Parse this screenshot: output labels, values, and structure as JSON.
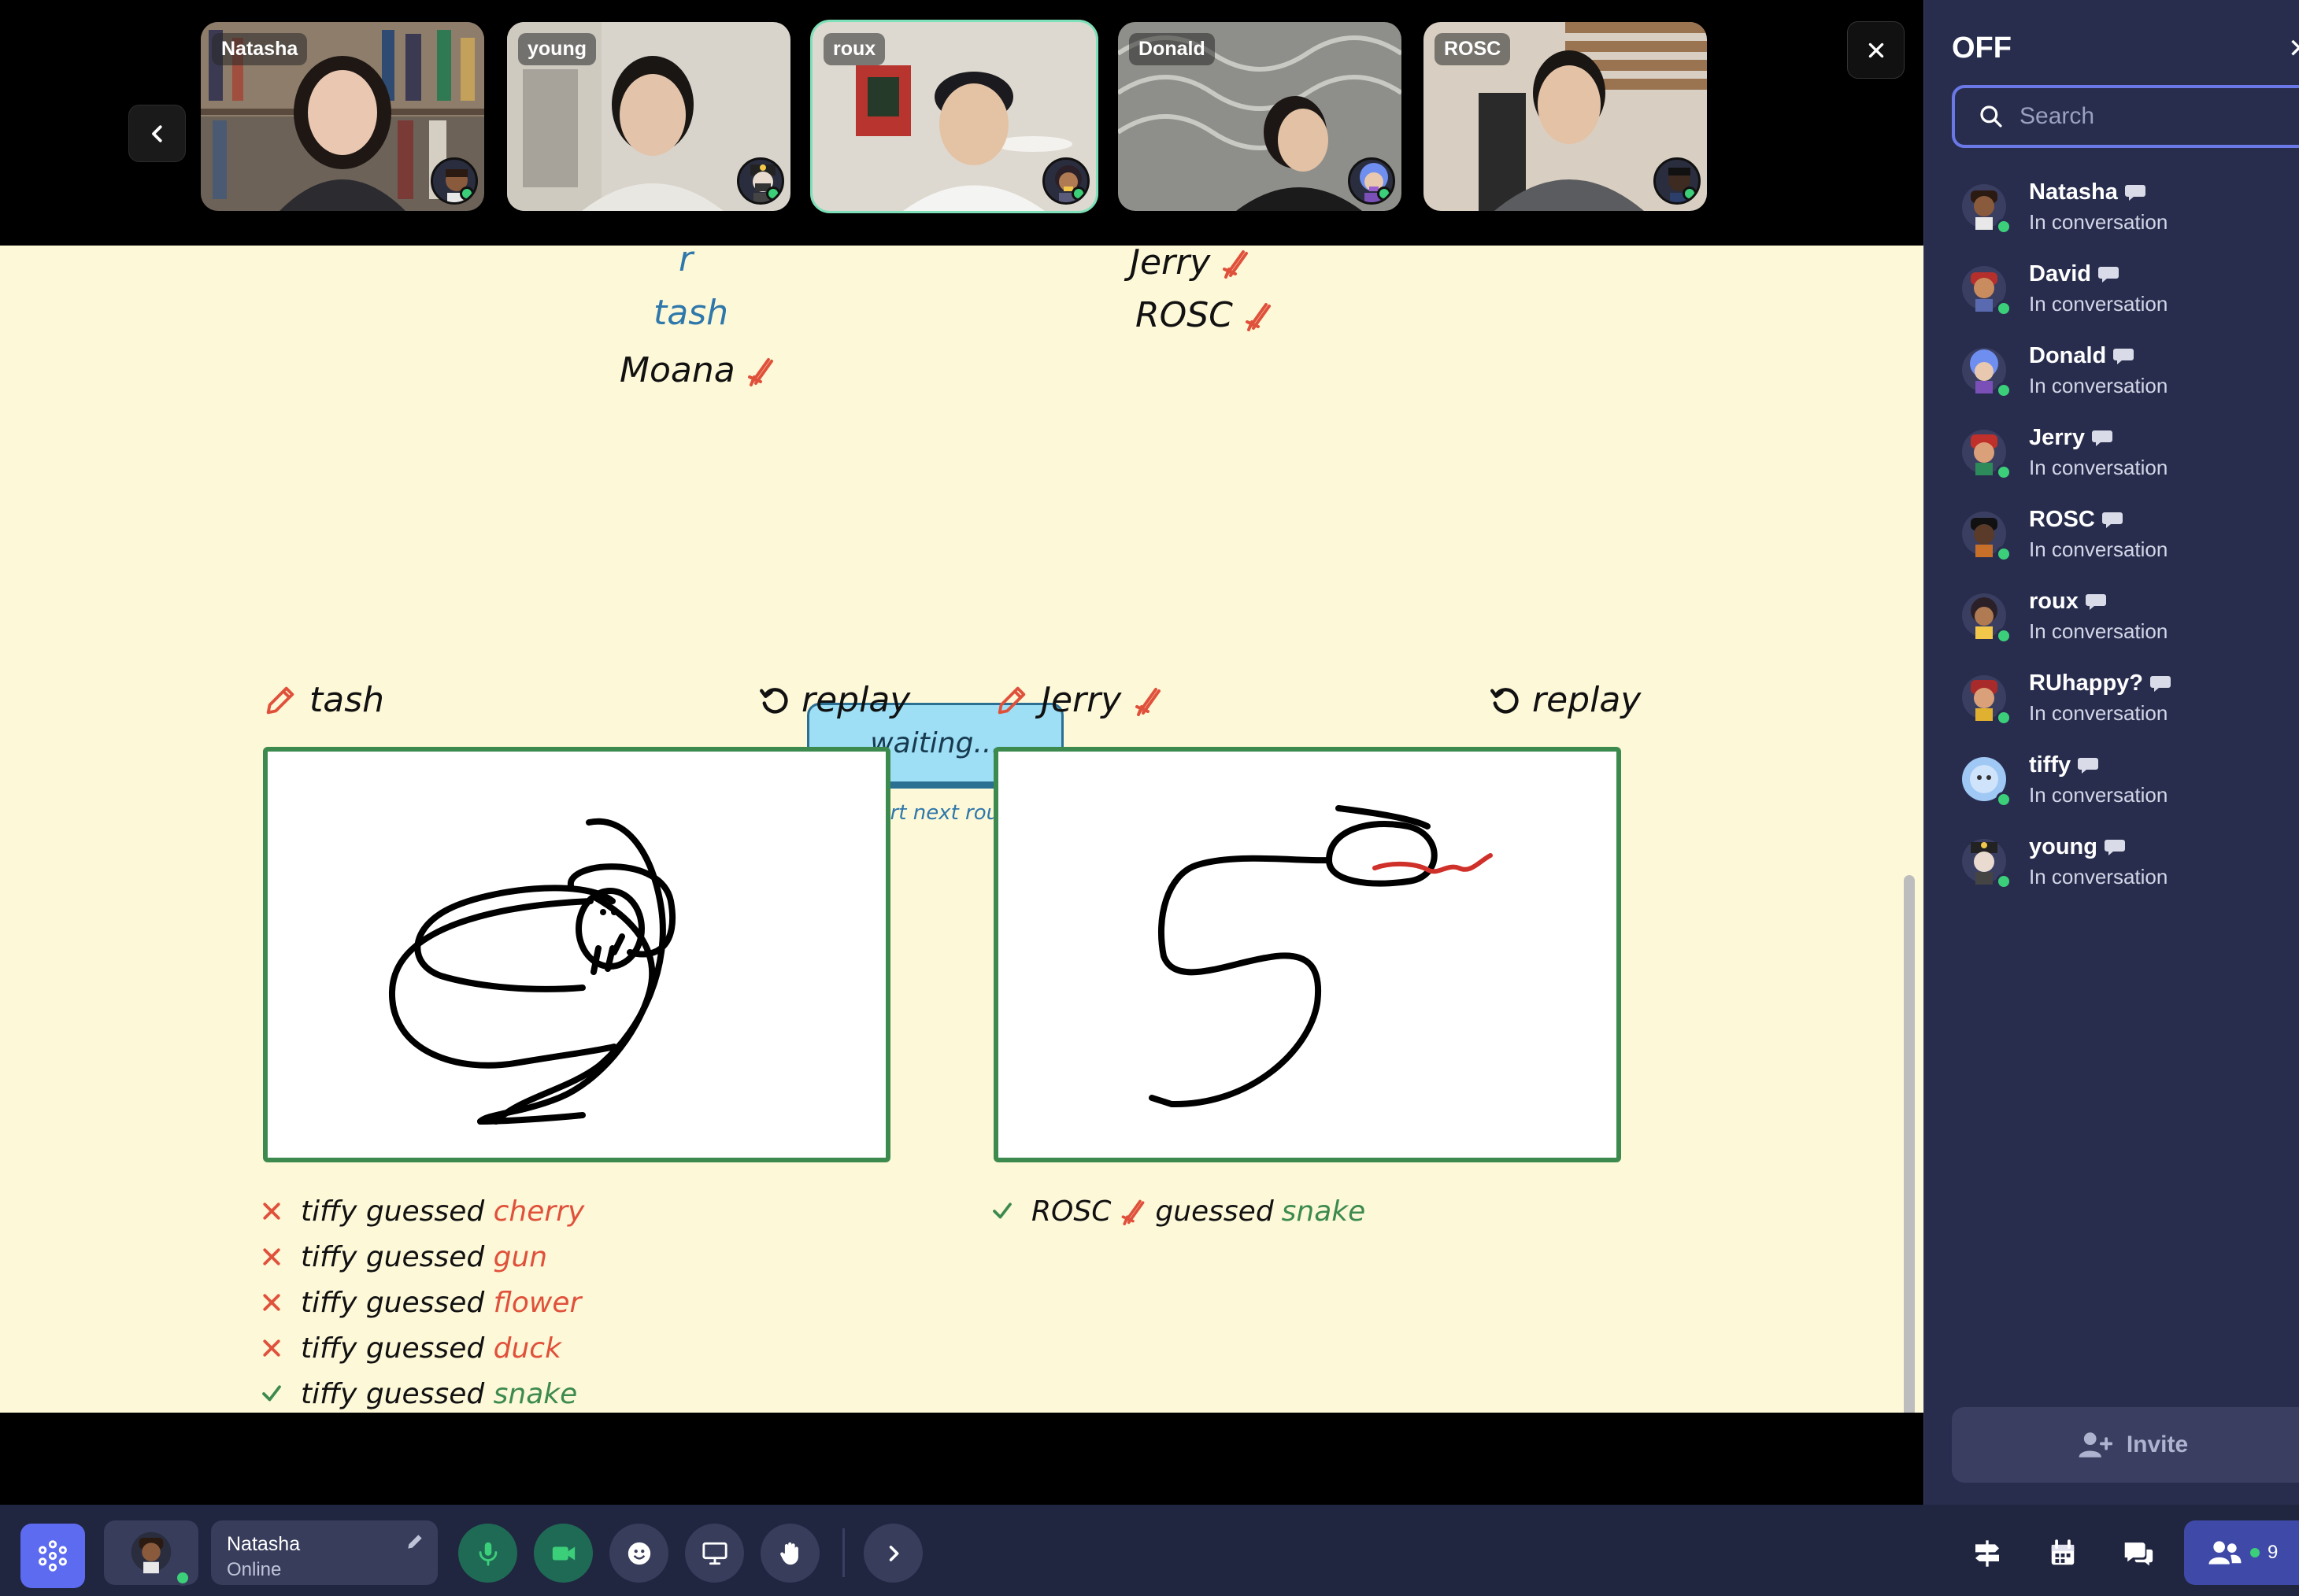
{
  "strip": {
    "tiles": [
      {
        "name": "Natasha"
      },
      {
        "name": "young"
      },
      {
        "name": "roux"
      },
      {
        "name": "Donald"
      },
      {
        "name": "ROSC"
      }
    ]
  },
  "scoreboard": {
    "left": [
      {
        "name": "r",
        "highlight": true,
        "icon": false
      },
      {
        "name": "tash",
        "highlight": true,
        "icon": false
      },
      {
        "name": "Moana",
        "highlight": false,
        "icon": true
      }
    ],
    "right": [
      {
        "name": "Jerry",
        "icon": true
      },
      {
        "name": "ROSC",
        "icon": true
      }
    ]
  },
  "round": {
    "waiting_label": "waiting...",
    "next_label": "start next round"
  },
  "cards": [
    {
      "artist": "tash",
      "replay_label": "replay",
      "guesses": [
        {
          "guesser": "tiffy",
          "verb": "guessed",
          "word": "cherry",
          "correct": false
        },
        {
          "guesser": "tiffy",
          "verb": "guessed",
          "word": "gun",
          "correct": false
        },
        {
          "guesser": "tiffy",
          "verb": "guessed",
          "word": "flower",
          "correct": false
        },
        {
          "guesser": "tiffy",
          "verb": "guessed",
          "word": "duck",
          "correct": false
        },
        {
          "guesser": "tiffy",
          "verb": "guessed",
          "word": "snake",
          "correct": true
        }
      ]
    },
    {
      "artist": "Jerry",
      "replay_label": "replay",
      "guesses": [
        {
          "guesser": "ROSC",
          "verb": "guessed",
          "word": "snake",
          "correct": true
        }
      ]
    }
  ],
  "sidebar": {
    "title": "OFF",
    "search_placeholder": "Search",
    "members": [
      {
        "name": "Natasha",
        "status": "In conversation"
      },
      {
        "name": "David",
        "status": "In conversation"
      },
      {
        "name": "Donald",
        "status": "In conversation"
      },
      {
        "name": "Jerry",
        "status": "In conversation"
      },
      {
        "name": "ROSC",
        "status": "In conversation"
      },
      {
        "name": "roux",
        "status": "In conversation"
      },
      {
        "name": "RUhappy?",
        "status": "In conversation"
      },
      {
        "name": "tiffy",
        "status": "In conversation"
      },
      {
        "name": "young",
        "status": "In conversation"
      }
    ],
    "invite_label": "Invite"
  },
  "bottom_bar": {
    "user_name": "Natasha",
    "user_status": "Online",
    "people_count": "9"
  },
  "colors": {
    "accent": "#6b79e8",
    "online": "#3ccf7a",
    "wrong": "#e0513b",
    "correct": "#3d8a4f"
  }
}
